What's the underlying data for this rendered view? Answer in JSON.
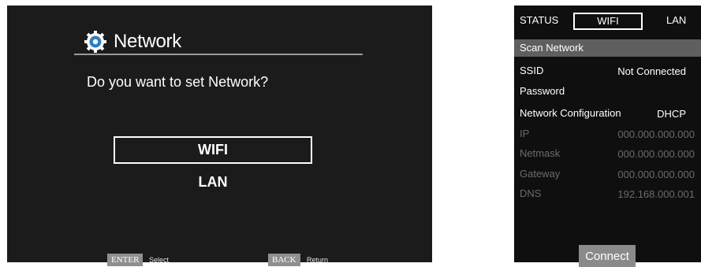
{
  "left": {
    "title": "Network",
    "question": "Do you want to set Network?",
    "options": [
      "WIFI",
      "LAN"
    ],
    "selected_option": "WIFI",
    "hints": [
      {
        "key": "ENTER",
        "label": "Select"
      },
      {
        "key": "BACK",
        "label": "Return"
      }
    ]
  },
  "right": {
    "tabs": [
      "STATUS",
      "WIFI",
      "LAN"
    ],
    "active_tab": "WIFI",
    "scan_label": "Scan Network",
    "ssid_label": "SSID",
    "ssid_value": "Not Connected",
    "password_label": "Password",
    "config_label": "Network Configuration",
    "config_value": "DHCP",
    "fields": [
      {
        "label": "IP",
        "value": "000.000.000.000"
      },
      {
        "label": "Netmask",
        "value": "000.000.000.000"
      },
      {
        "label": "Gateway",
        "value": "000.000.000.000"
      },
      {
        "label": "DNS",
        "value": "192.168.000.001"
      }
    ],
    "connect_label": "Connect"
  },
  "colors": {
    "panel_bg": "#1b1b1b",
    "highlight_row": "#5f5f5f",
    "disabled_text": "#6b6b6b",
    "button_bg": "#8a8a8a"
  }
}
